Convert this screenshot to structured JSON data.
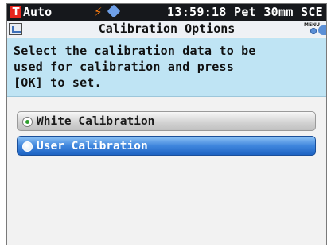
{
  "status_bar": {
    "mode_icon_letter": "T",
    "mode_label": "Auto",
    "flash_icon": "lightning-bolt-icon",
    "pen_icon": "pencil-icon",
    "status_text": "13:59:18 Pet 30mm SCE"
  },
  "title_bar": {
    "back_icon": "return-icon",
    "title": "Calibration Options",
    "menu_icon_label": "MENU"
  },
  "instructions": {
    "lines": [
      "Select the calibration data to be",
      "used for calibration and press",
      "[OK] to set."
    ]
  },
  "options": [
    {
      "label": "White Calibration",
      "selected": true,
      "focused": false
    },
    {
      "label": "User Calibration",
      "selected": false,
      "focused": true
    }
  ],
  "colors": {
    "status_bar_bg": "#16181c",
    "mode_icon": "#e8261e",
    "flash_icon": "#ff7d0f",
    "instruction_bg": "#bfe4f4",
    "focused_option": "#3f86dd",
    "selected_radio_dot": "#2e9e2e"
  }
}
